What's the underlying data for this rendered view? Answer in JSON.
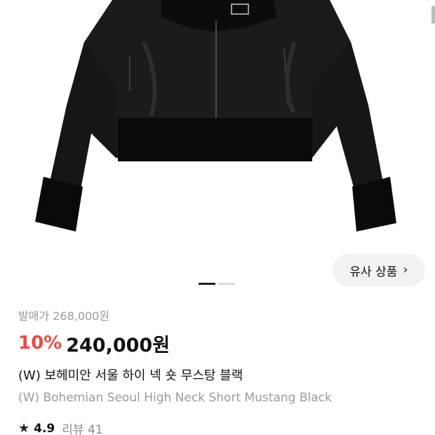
{
  "similar_button": {
    "label": "유사 상품",
    "chevron": "›"
  },
  "carousel": {
    "pages": 2,
    "active_index": 0
  },
  "product": {
    "original_price": "발매가 268,000원",
    "discount": "10%",
    "price": "240,000원",
    "name_ko": "(W) 보헤미안 서울 하이 넥 숏 무스탕 블랙",
    "name_en": "(W) Bohemian Seoul High Neck Short Mustang Black"
  },
  "rating": {
    "star_icon": "★",
    "score": "4.9",
    "review_label": "리뷰 41"
  },
  "colors": {
    "discount": "#f04a3f",
    "muted": "#9a9a9a",
    "button_bg": "#f2f2f2"
  },
  "icons": {
    "image": "black-shearling-jacket",
    "star": "star-icon",
    "chevron": "chevron-right-icon"
  }
}
